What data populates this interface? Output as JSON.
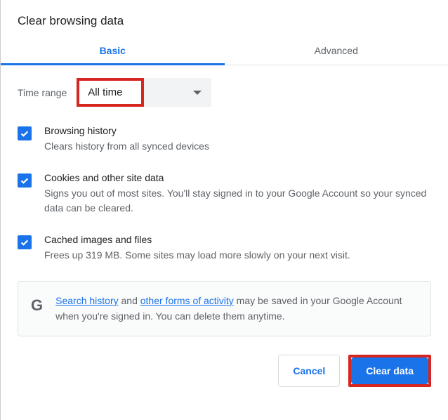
{
  "title": "Clear browsing data",
  "tabs": {
    "basic": "Basic",
    "advanced": "Advanced"
  },
  "timerange": {
    "label": "Time range",
    "value": "All time"
  },
  "items": [
    {
      "title": "Browsing history",
      "desc": "Clears history from all synced devices"
    },
    {
      "title": "Cookies and other site data",
      "desc": "Signs you out of most sites. You'll stay signed in to your Google Account so your synced data can be cleared."
    },
    {
      "title": "Cached images and files",
      "desc": "Frees up 319 MB. Some sites may load more slowly on your next visit."
    }
  ],
  "info": {
    "g": "G",
    "link1": "Search history",
    "mid1": " and ",
    "link2": "other forms of activity",
    "tail": " may be saved in your Google Account when you're signed in. You can delete them anytime."
  },
  "footer": {
    "cancel": "Cancel",
    "clear": "Clear data"
  }
}
